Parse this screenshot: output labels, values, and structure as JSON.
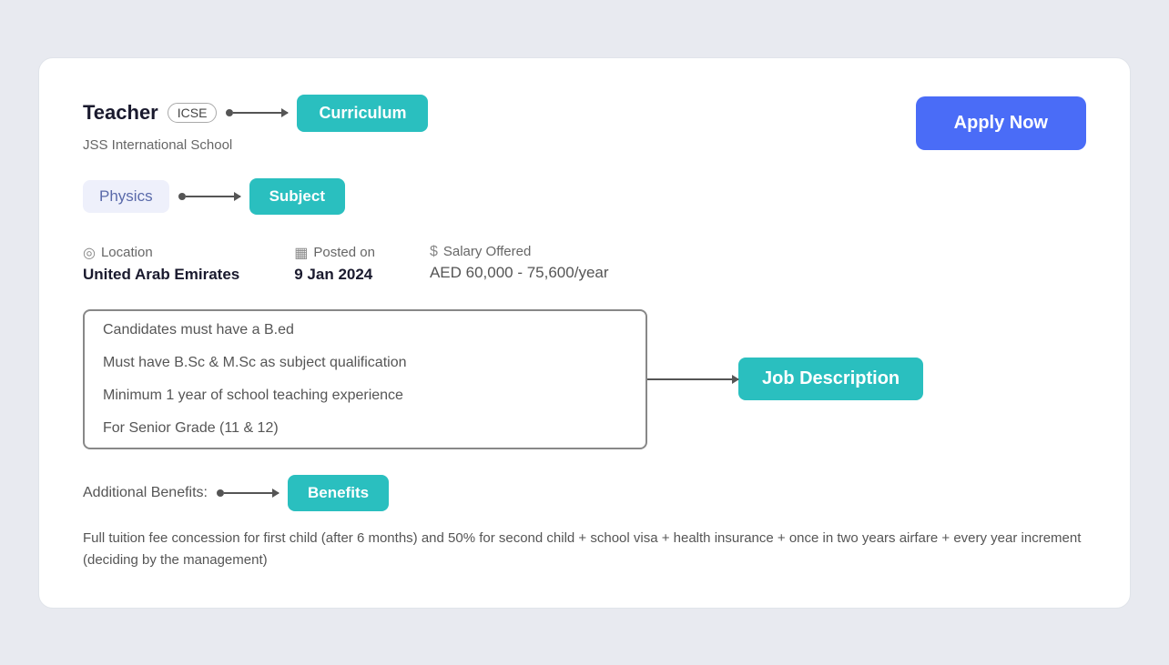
{
  "header": {
    "teacher_label": "Teacher",
    "icse_badge": "ICSE",
    "curriculum_btn": "Curriculum",
    "school_name": "JSS International School",
    "apply_btn": "Apply Now"
  },
  "subject_section": {
    "physics_badge": "Physics",
    "subject_btn": "Subject"
  },
  "info": {
    "location_label": "Location",
    "location_value": "United Arab Emirates",
    "posted_label": "Posted on",
    "posted_value": "9 Jan 2024",
    "salary_label": "Salary Offered",
    "salary_value": "AED 60,000 - 75,600",
    "salary_suffix": "/year"
  },
  "job_description": {
    "btn_label": "Job Description",
    "items": [
      "Candidates must have a B.ed",
      "Must have B.Sc & M.Sc as subject qualification",
      "Minimum 1 year of school teaching experience",
      "For Senior Grade (11 & 12)"
    ]
  },
  "benefits": {
    "label": "Additional Benefits:",
    "btn_label": "Benefits",
    "text": "Full tuition fee concession for first child (after 6 months) and 50% for second child + school visa + health insurance + once in two years airfare + every year increment (deciding by the management)"
  },
  "icons": {
    "location": "📍",
    "calendar": "📅",
    "salary": "💲"
  }
}
